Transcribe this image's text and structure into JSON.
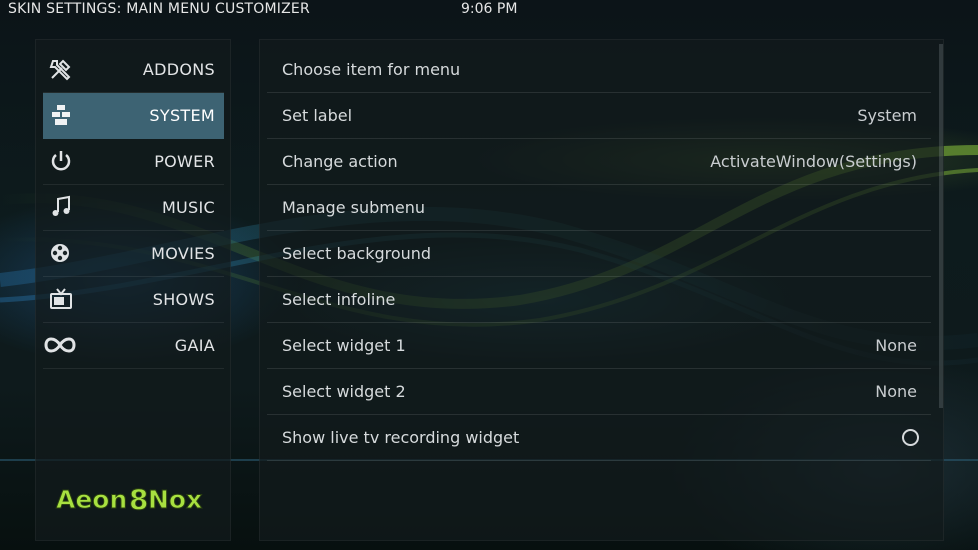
{
  "header": {
    "title": "SKIN SETTINGS: MAIN MENU CUSTOMIZER",
    "clock": "9:06 PM"
  },
  "sidebar": {
    "items": [
      {
        "label": "ADDONS",
        "icon": "tools-icon",
        "selected": false
      },
      {
        "label": "SYSTEM",
        "icon": "system-icon",
        "selected": true
      },
      {
        "label": "POWER",
        "icon": "power-icon",
        "selected": false
      },
      {
        "label": "MUSIC",
        "icon": "music-note-icon",
        "selected": false
      },
      {
        "label": "MOVIES",
        "icon": "film-reel-icon",
        "selected": false
      },
      {
        "label": "SHOWS",
        "icon": "tv-icon",
        "selected": false
      },
      {
        "label": "GAIA",
        "icon": "gaia-icon",
        "selected": false
      }
    ],
    "logo": "Aeon Nox"
  },
  "main": {
    "rows": [
      {
        "label": "Choose item for menu",
        "value": ""
      },
      {
        "label": "Set label",
        "value": "System"
      },
      {
        "label": "Change action",
        "value": "ActivateWindow(Settings)"
      },
      {
        "label": "Manage submenu",
        "value": ""
      },
      {
        "label": "Select background",
        "value": ""
      },
      {
        "label": "Select infoline",
        "value": ""
      },
      {
        "label": "Select widget 1",
        "value": "None"
      },
      {
        "label": "Select widget 2",
        "value": "None"
      },
      {
        "label": "Show live tv recording widget",
        "value": "",
        "toggle": false
      }
    ]
  },
  "colors": {
    "selected_bg": "#3d6373",
    "logo_green": "#a8e040"
  }
}
